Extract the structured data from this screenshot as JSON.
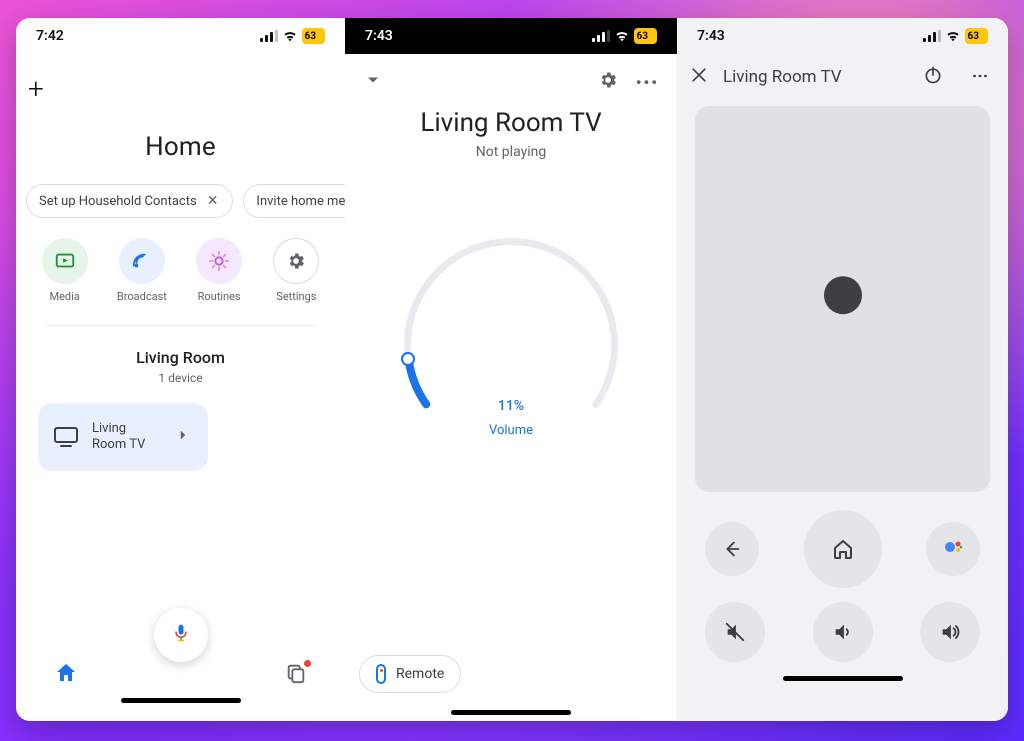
{
  "status": {
    "time1": "7:42",
    "time2": "7:43",
    "time3": "7:43",
    "battery": "63"
  },
  "screen1": {
    "home_title": "Home",
    "chips": [
      {
        "label": "Set up Household Contacts",
        "closable": true
      },
      {
        "label": "Invite home mem",
        "closable": false
      }
    ],
    "quick_actions": [
      {
        "id": "media",
        "label": "Media"
      },
      {
        "id": "broadcast",
        "label": "Broadcast"
      },
      {
        "id": "routines",
        "label": "Routines"
      },
      {
        "id": "settings",
        "label": "Settings"
      }
    ],
    "room": {
      "name": "Living Room",
      "count_label": "1 device"
    },
    "device": {
      "name": "Living Room TV"
    }
  },
  "screen2": {
    "title": "Living Room TV",
    "subtitle": "Not playing",
    "volume_pct_label": "11%",
    "volume_pct": 11,
    "volume_caption": "Volume",
    "remote_label": "Remote"
  },
  "screen3": {
    "title": "Living Room TV"
  },
  "colors": {
    "blue": "#1a73e8",
    "grey": "#5f6368",
    "track": "#e8eaed",
    "surfaceGrey": "#e0e1e4"
  }
}
